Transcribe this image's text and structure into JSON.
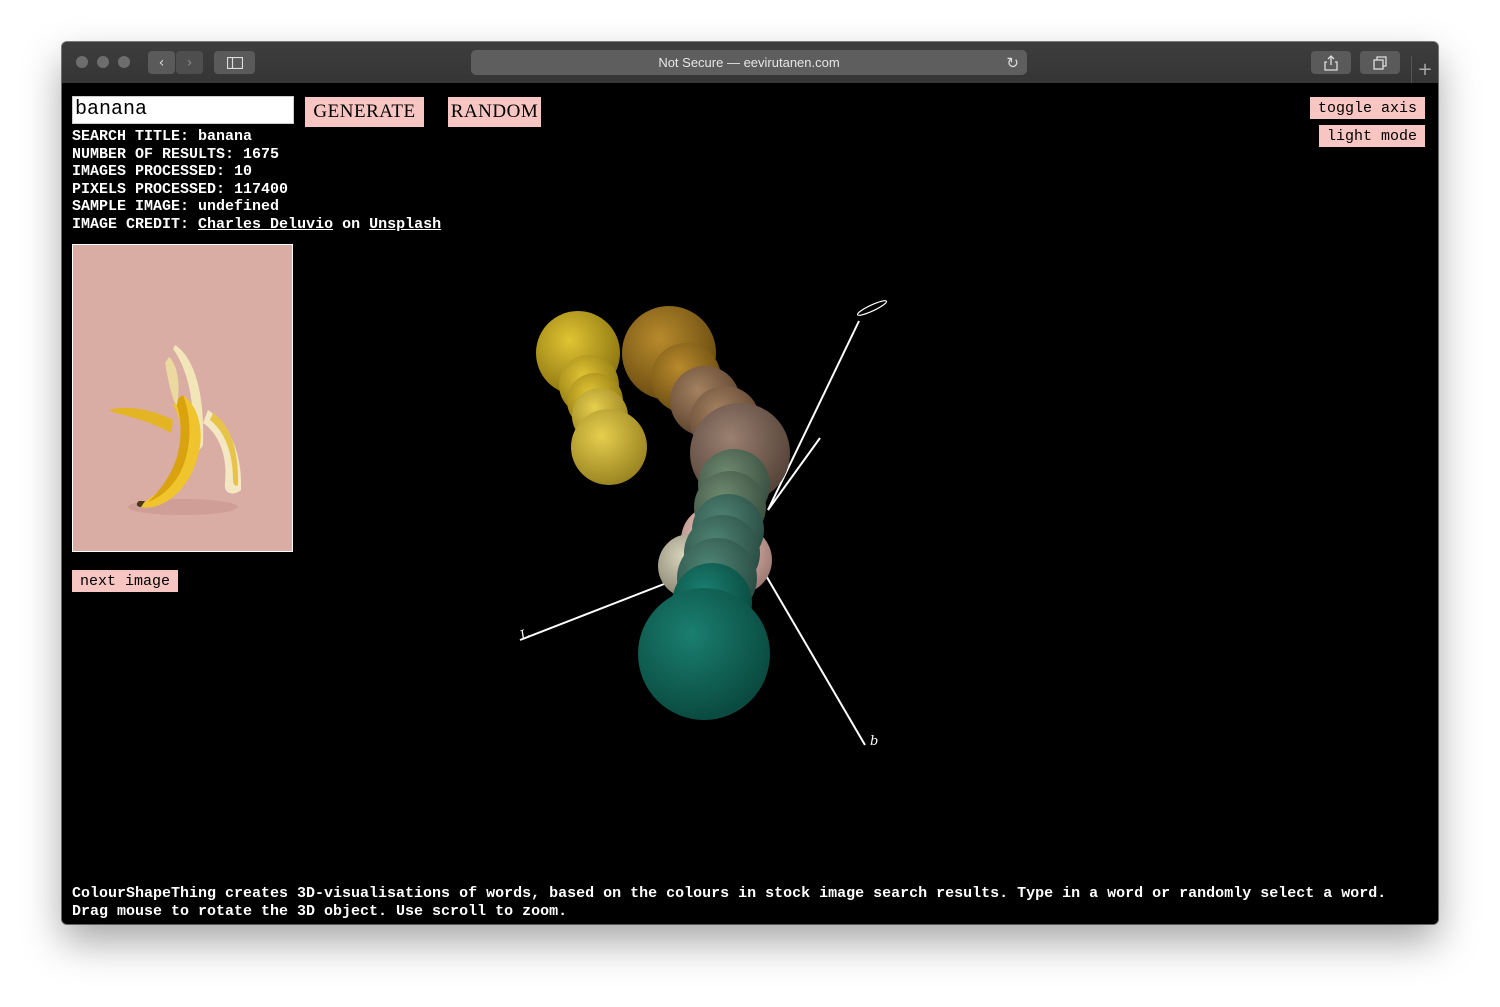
{
  "browser": {
    "address": "Not Secure — eevirutanen.com",
    "back_icon": "chevron-left-icon",
    "forward_icon": "chevron-right-icon",
    "sidebar_icon": "sidebar-icon",
    "reload_icon": "reload-icon",
    "share_icon": "share-icon",
    "tabs_icon": "tabs-icon",
    "new_tab_icon": "plus-icon"
  },
  "controls": {
    "search_value": "banana",
    "generate_label": "GENERATE",
    "random_label": "RANDOM",
    "toggle_axis_label": "toggle axis",
    "light_mode_label": "light mode",
    "next_image_label": "next image"
  },
  "info": {
    "search_title_label": "SEARCH TITLE:",
    "search_title": "banana",
    "results_label": "NUMBER OF RESULTS:",
    "results": "1675",
    "images_label": "IMAGES PROCESSED:",
    "images": "10",
    "pixels_label": "PIXELS PROCESSED:",
    "pixels": "117400",
    "sample_label": "SAMPLE IMAGE:",
    "sample": "undefined",
    "credit_label": "IMAGE CREDIT:",
    "credit_author": "Charles Deluvio",
    "credit_on": "on",
    "credit_source": "Unsplash"
  },
  "visualization": {
    "axis_labels": [
      "a",
      "b",
      "L"
    ]
  },
  "footer": {
    "line1": "ColourShapeThing creates 3D-visualisations of words, based on the colours in stock image search results. Type in a word or randomly select a word.",
    "line2": "Drag mouse to rotate the 3D object. Use scroll to zoom."
  },
  "colors": {
    "button_pink": "#f7c6c2",
    "background": "#000000",
    "image_bg": "#d7aaa3"
  }
}
